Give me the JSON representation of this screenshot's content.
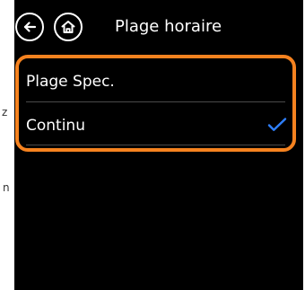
{
  "background_fragments": [
    {
      "text": "z"
    },
    {
      "text": "n"
    }
  ],
  "header": {
    "back_icon": "back-arrow-icon",
    "home_icon": "home-icon",
    "title": "Plage horaire"
  },
  "options": [
    {
      "label": "Plage Spec.",
      "selected": false
    },
    {
      "label": "Continu",
      "selected": true
    }
  ],
  "colors": {
    "screen_background": "#000000",
    "highlight_border": "#f5821f",
    "checkmark": "#2f80ff",
    "text": "#ffffff"
  },
  "icons": {
    "selected_marker": "checkmark-icon"
  }
}
